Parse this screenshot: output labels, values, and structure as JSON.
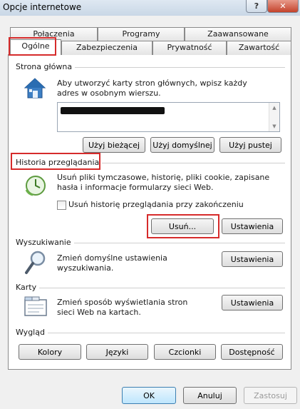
{
  "window": {
    "title": "Opcje internetowe",
    "help_label": "?",
    "close_label": "✕"
  },
  "tabs": {
    "row_back": [
      "Połączenia",
      "Programy",
      "Zaawansowane"
    ],
    "row_front": [
      "Ogólne",
      "Zabezpieczenia",
      "Prywatność",
      "Zawartość"
    ],
    "selected": "Ogólne"
  },
  "home": {
    "group_label": "Strona główna",
    "description": "Aby utworzyć karty stron głównych, wpisz każdy adres w osobnym wierszu.",
    "buttons": [
      "Użyj bieżącej",
      "Użyj domyślnej",
      "Użyj pustej"
    ]
  },
  "history": {
    "group_label": "Historia przeglądania",
    "description": "Usuń pliki tymczasowe, historię, pliki cookie, zapisane hasła i informacje formularzy sieci Web.",
    "checkbox_label": "Usuń historię przeglądania przy zakończeniu",
    "checkbox_checked": false,
    "delete_button": "Usuń...",
    "settings_button": "Ustawienia"
  },
  "search": {
    "group_label": "Wyszukiwanie",
    "description": "Zmień domyślne ustawienia wyszukiwania.",
    "settings_button": "Ustawienia"
  },
  "tabs_group": {
    "group_label": "Karty",
    "description": "Zmień sposób wyświetlania stron sieci Web na kartach.",
    "settings_button": "Ustawienia"
  },
  "appearance": {
    "group_label": "Wygląd",
    "buttons": [
      "Kolory",
      "Języki",
      "Czcionki",
      "Dostępność"
    ]
  },
  "footer": {
    "ok": "OK",
    "cancel": "Anuluj",
    "apply": "Zastosuj"
  },
  "colors": {
    "highlight_box": "#d62b2b",
    "accent": "#3c7fb1"
  }
}
